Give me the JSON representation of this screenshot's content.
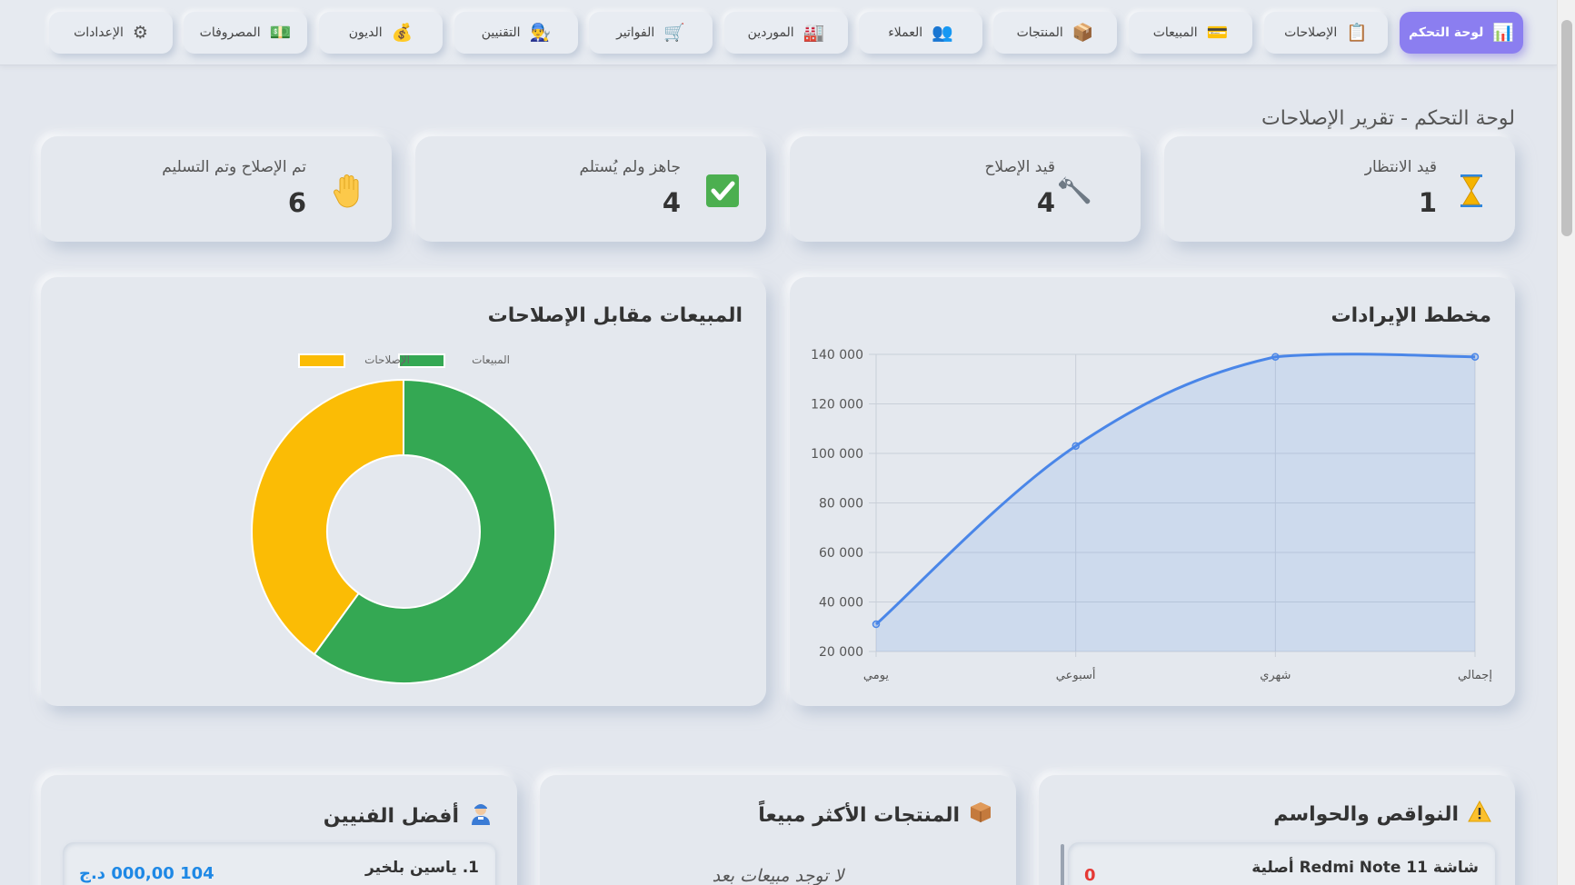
{
  "nav": {
    "items": [
      {
        "label": "لوحة التحكم",
        "icon": "📊",
        "active": true
      },
      {
        "label": "الإصلاحات",
        "icon": "📋"
      },
      {
        "label": "المبيعات",
        "icon": "💳"
      },
      {
        "label": "المنتجات",
        "icon": "📦"
      },
      {
        "label": "العملاء",
        "icon": "👥"
      },
      {
        "label": "الموردين",
        "icon": "🏭"
      },
      {
        "label": "الفواتير",
        "icon": "🛒"
      },
      {
        "label": "التقنيين",
        "icon": "👨‍🔧"
      },
      {
        "label": "الديون",
        "icon": "💰"
      },
      {
        "label": "المصروفات",
        "icon": "💵"
      },
      {
        "label": "الإعدادات",
        "icon": "⚙"
      }
    ]
  },
  "page": {
    "title": "لوحة التحكم - تقرير الإصلاحات"
  },
  "stats": [
    {
      "label": "قيد الانتظار",
      "value": "1",
      "icon": "hourglass-icon"
    },
    {
      "label": "قيد الإصلاح",
      "value": "4",
      "icon": "wrench-icon"
    },
    {
      "label": "جاهز ولم يُستلم",
      "value": "4",
      "icon": "checkmark-icon"
    },
    {
      "label": "تم الإصلاح وتم التسليم",
      "value": "6",
      "icon": "hand-icon"
    }
  ],
  "revenue_chart": {
    "title": "مخطط الإيرادات"
  },
  "donut_chart": {
    "title": "المبيعات مقابل الإصلاحات"
  },
  "chart_data": [
    {
      "type": "line",
      "title": "مخطط الإيرادات",
      "categories": [
        "يومي",
        "أسبوعي",
        "شهري",
        "إجمالي"
      ],
      "series": [
        {
          "values": [
            31000,
            103000,
            139000,
            139000
          ]
        }
      ],
      "yticks": [
        "20 000",
        "40 000",
        "60 000",
        "80 000",
        "100 000",
        "120 000",
        "140 000"
      ],
      "ylim": [
        20000,
        140000
      ],
      "fill": true,
      "grid": true,
      "color": "#4a86e8"
    },
    {
      "type": "pie",
      "title": "المبيعات مقابل الإصلاحات",
      "labels": [
        "المبيعات",
        "الإصلاحات"
      ],
      "values": [
        60,
        40
      ],
      "colors": [
        "#34a853",
        "#fbbc05"
      ],
      "legend": "top"
    }
  ],
  "panels": {
    "shortages": {
      "title": "النواقص والحواسم",
      "icon": "warning-icon",
      "items": [
        {
          "name": "شاشة Redmi Note 11 أصلية",
          "qty": "0"
        }
      ]
    },
    "top_products": {
      "title": "المنتجات الأكثر مبيعاً",
      "icon": "package-icon",
      "empty": "لا توجد مبيعات بعد"
    },
    "top_technicians": {
      "title": "أفضل الفنيين",
      "icon": "technician-icon",
      "items": [
        {
          "name": "1. ياسين بلخير",
          "amount": "104 000,00 د.ج"
        }
      ]
    }
  }
}
